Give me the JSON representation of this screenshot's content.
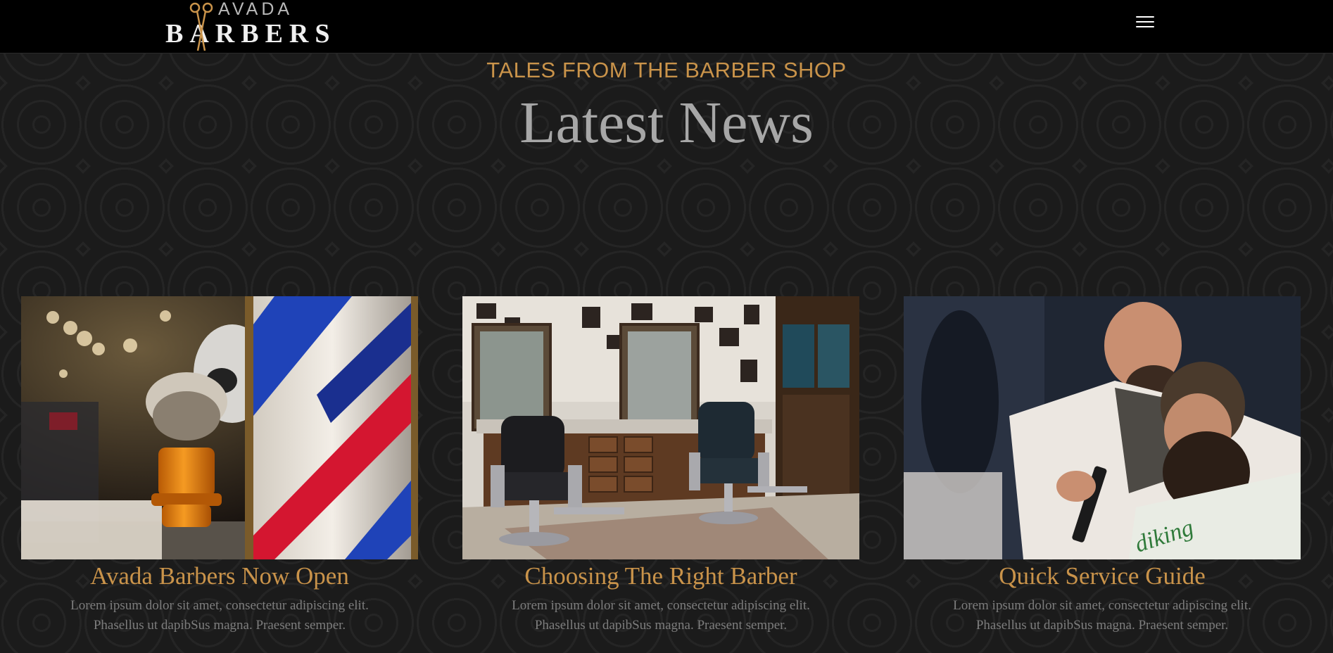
{
  "header": {
    "logo_top": "AVADA",
    "logo_bottom": "BARBERS",
    "menu_icon": "hamburger-menu-icon"
  },
  "intro": {
    "eyebrow": "TALES FROM THE BARBER SHOP",
    "title": "Latest News"
  },
  "posts": [
    {
      "title": "Avada Barbers Now Open",
      "line1": "Lorem ipsum dolor sit amet, consectetur adipiscing elit.",
      "line2": "Phasellus ut dapibSus magna. Praesent semper.",
      "image": "shaving-brush-and-barber-pole-photo"
    },
    {
      "title": "Choosing The Right Barber",
      "line1": "Lorem ipsum dolor sit amet, consectetur adipiscing elit.",
      "line2": "Phasellus ut dapibSus magna. Praesent semper.",
      "image": "barber-shop-chairs-photo"
    },
    {
      "title": "Quick Service Guide",
      "line1": "Lorem ipsum dolor sit amet, consectetur adipiscing elit.",
      "line2": "Phasellus ut dapibSus magna. Praesent semper.",
      "image": "barber-trimming-beard-photo"
    }
  ],
  "colors": {
    "accent": "#c9934a",
    "heading": "#a7a7a7",
    "body_text": "#7d7d7d",
    "background": "#1b1b1b",
    "topbar": "#000000"
  }
}
